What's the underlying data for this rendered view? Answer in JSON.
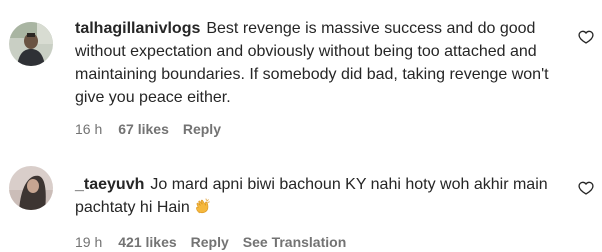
{
  "comments": [
    {
      "username": "talhagillanivlogs",
      "text": "Best revenge is massive success and do good without expectation and obviously without being too attached and maintaining boundaries. If somebody did bad, taking revenge won't give you peace either.",
      "time": "16 h",
      "likes": "67 likes",
      "reply": "Reply"
    },
    {
      "username": "_taeyuvh",
      "text": "Jo mard apni biwi bachoun KY nahi hoty woh akhir main pachtaty hi Hain",
      "emoji": "clapping-hands",
      "time": "19 h",
      "likes": "421 likes",
      "reply": "Reply",
      "translation": "See Translation"
    }
  ],
  "colors": {
    "text": "#262626",
    "secondary": "#737373",
    "emoji": "#f5b83d"
  },
  "icons": {
    "like": "heart-outline-icon"
  }
}
